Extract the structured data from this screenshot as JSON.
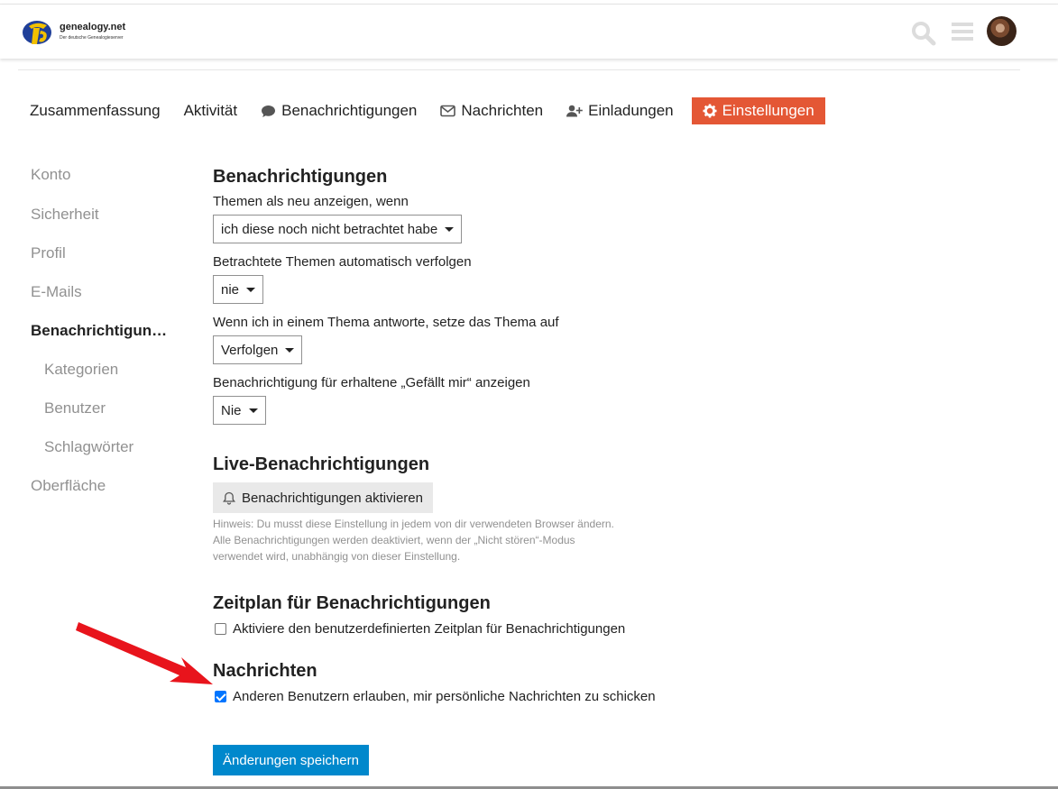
{
  "header": {
    "logo_title": "genealogy.net",
    "logo_subtitle": "Der deutsche Genealogieserver",
    "icons": [
      "search-icon",
      "hamburger-menu-icon",
      "user-avatar"
    ]
  },
  "nav": {
    "items": [
      "Zusammenfassung",
      "Aktivität",
      "Benachrichtigungen",
      "Nachrichten",
      "Einladungen",
      "Einstellungen"
    ],
    "active": "Einstellungen"
  },
  "sidebar": {
    "items": [
      "Konto",
      "Sicherheit",
      "Profil",
      "E-Mails",
      "Benachrichtigun…",
      "Kategorien",
      "Benutzer",
      "Schlagwörter",
      "Oberfläche"
    ],
    "active": "Benachrichtigun…"
  },
  "notifications": {
    "heading": "Benachrichtigungen",
    "new_topics_label": "Themen als neu anzeigen, wenn",
    "new_topics_value": "ich diese noch nicht betrachtet habe",
    "auto_track_label": "Betrachtete Themen automatisch verfolgen",
    "auto_track_value": "nie",
    "reply_label": "Wenn ich in einem Thema antworte, setze das Thema auf",
    "reply_value": "Verfolgen",
    "likes_label": "Benachrichtigung für erhaltene „Gefällt mir“ anzeigen",
    "likes_value": "Nie"
  },
  "live": {
    "heading": "Live-Benachrichtigungen",
    "button": "Benachrichtigungen aktivieren",
    "hint_1": "Hinweis: Du musst diese Einstellung in jedem von dir verwendeten Browser ändern.",
    "hint_2": "Alle Benachrichtigungen werden deaktiviert, wenn der „Nicht stören“-Modus",
    "hint_3": "verwendet wird, unabhängig von dieser Einstellung."
  },
  "schedule": {
    "heading": "Zeitplan für Benachrichtigungen",
    "checkbox_label": "Aktiviere den benutzerdefinierten Zeitplan für Benachrichtigungen",
    "checked": false
  },
  "messages": {
    "heading": "Nachrichten",
    "checkbox_label": "Anderen Benutzern erlauben, mir persönliche Nachrichten zu schicken",
    "checked": true
  },
  "save_button": "Änderungen speichern",
  "colors": {
    "accent_active_tab": "#e45735",
    "primary_button": "#0088cc",
    "checkbox": "#0075ff",
    "annotation_arrow": "#e8141c"
  }
}
